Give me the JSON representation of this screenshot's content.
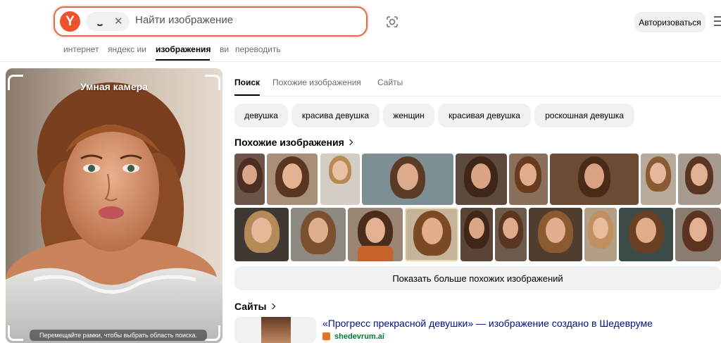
{
  "header": {
    "logo_letter": "Y",
    "search_placeholder": "Найти изображение",
    "login_label": "Авторизоваться"
  },
  "nav": {
    "items": [
      "интернет",
      "яндекс ии",
      "изображения",
      "ви",
      "переводить"
    ],
    "active_index": 2
  },
  "preview": {
    "title": "Умная камера",
    "hint": "Перемещайте рамки, чтобы выбрать область поиска."
  },
  "tabs": {
    "items": [
      "Поиск",
      "Похожие изображения",
      "Сайты"
    ],
    "active_index": 0
  },
  "tags": [
    "девушка",
    "красива девушка",
    "женщин",
    "красивая девушка",
    "роскошная девушка"
  ],
  "similar": {
    "title": "Похожие изображения",
    "more_label": "Показать больше похожих изображений"
  },
  "sites": {
    "title": "Сайты",
    "results": [
      {
        "title": "«Прогресс прекрасной девушки» — изображение создано в Шедевруме",
        "domain": "shedevrum.ai"
      }
    ]
  },
  "icons": {
    "logo": "yandex-logo-icon",
    "loading": "loading-spinner-icon",
    "close": "close-icon",
    "camera": "camera-search-icon",
    "menu": "hamburger-menu-icon",
    "chevron": "chevron-right-icon",
    "favicon": "site-favicon-icon"
  },
  "colors": {
    "accent": "#f0522d",
    "search_border": "#e06a4b",
    "link": "#000d8a",
    "domain": "#007a2f",
    "chip_bg": "#f0f1f3"
  }
}
